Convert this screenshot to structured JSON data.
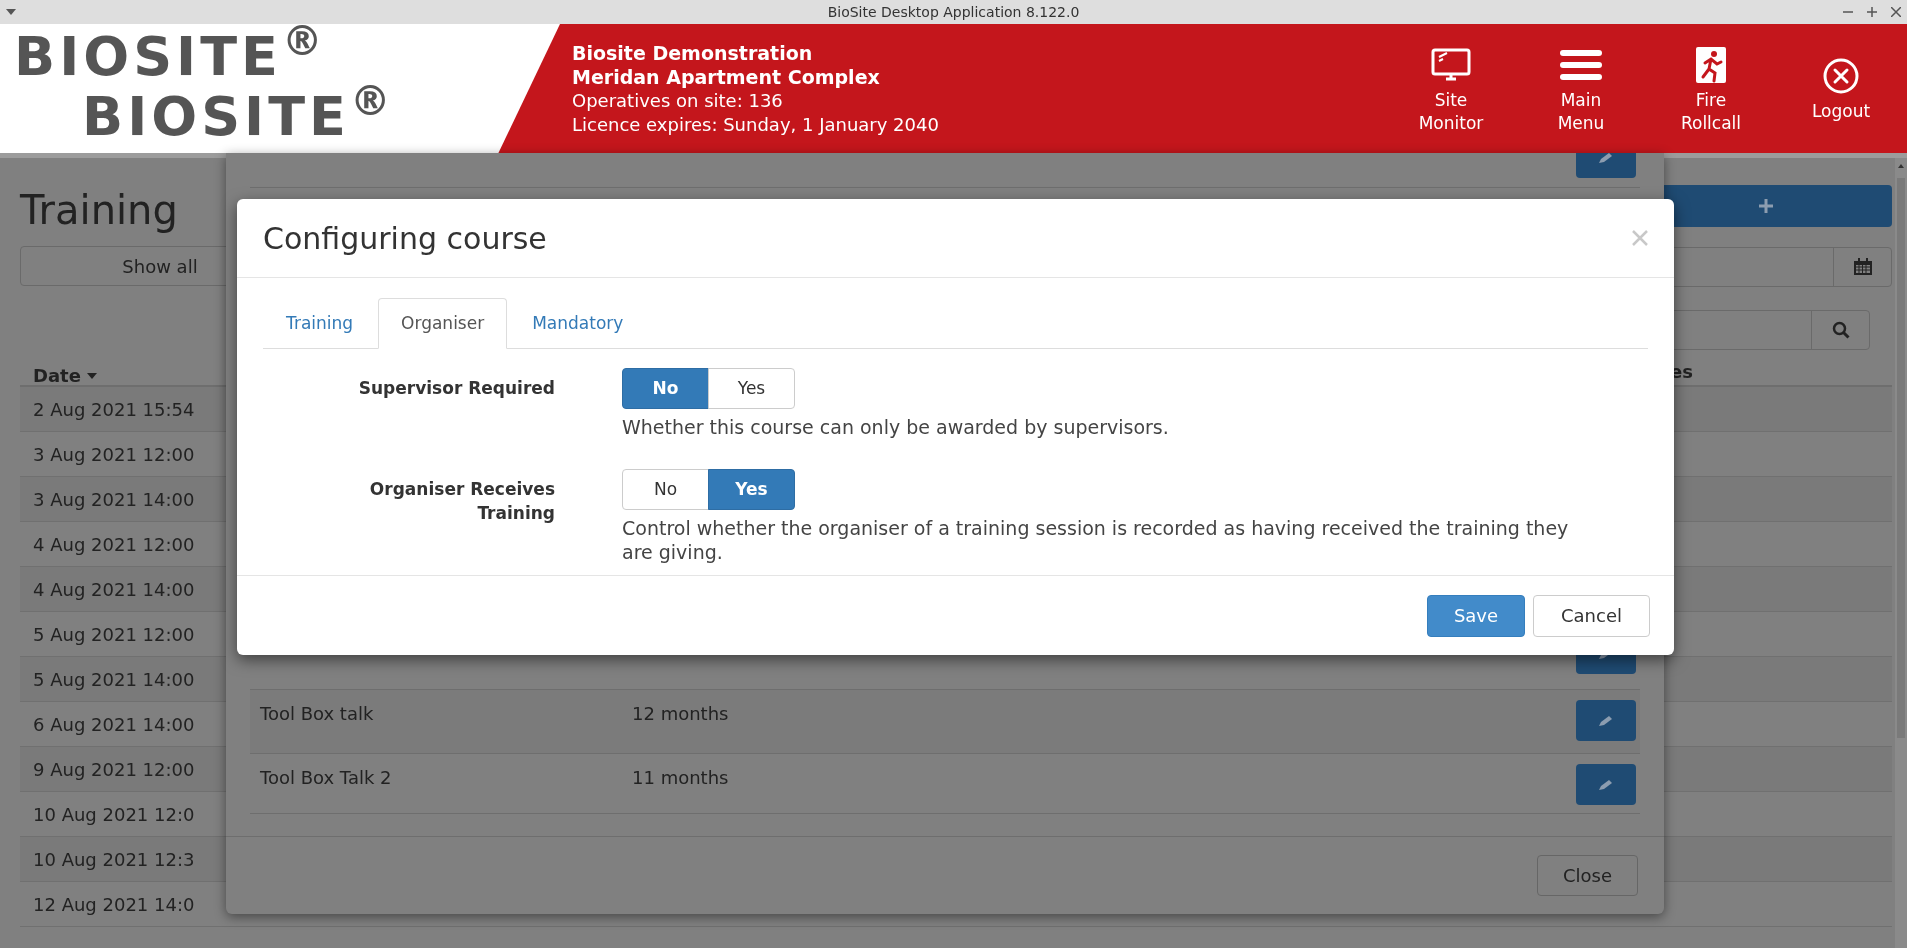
{
  "window": {
    "title": "BioSite Desktop Application 8.122.0"
  },
  "header": {
    "logos": [
      "BIOSITE$^{®}$",
      "BIOSITE$^{®}$"
    ],
    "info": {
      "company": "Biosite Demonstration",
      "site": "Meridan Apartment Complex",
      "operatives": "Operatives on site: 136",
      "licence": "Licence expires: Sunday, 1 January 2040"
    },
    "nav": [
      {
        "kind": "monitor",
        "label": "Site Monitor"
      },
      {
        "kind": "menu",
        "label": "Main Menu"
      },
      {
        "kind": "fire",
        "label": "Fire Rollcall"
      },
      {
        "kind": "logout",
        "label": "Logout"
      }
    ]
  },
  "page": {
    "title": "Training",
    "show_all": "Show all",
    "column_1": "Date",
    "column_partial": "es",
    "rows": [
      "2 Aug 2021 15:54",
      "3 Aug 2021 12:00",
      "3 Aug 2021 14:00",
      "4 Aug 2021 12:00",
      "4 Aug 2021 14:00",
      "5 Aug 2021 12:00",
      "5 Aug 2021 14:00",
      "6 Aug 2021 14:00",
      "9 Aug 2021 12:00",
      "10 Aug 2021 12:0",
      "10 Aug 2021 12:3",
      "12 Aug 2021 14:0"
    ]
  },
  "courses_dialog": {
    "rows": [
      {
        "name": "Tool Box talk",
        "period": "12 months"
      },
      {
        "name": "Tool Box Talk 2",
        "period": "11 months"
      }
    ],
    "close": "Close"
  },
  "dialog": {
    "title": "Configuring course",
    "tabs": [
      {
        "label": "Training",
        "selected": false
      },
      {
        "label": "Organiser",
        "selected": true
      },
      {
        "label": "Mandatory",
        "selected": false
      }
    ],
    "fields": [
      {
        "label": "Supervisor Required",
        "options": [
          {
            "label": "No",
            "selected": true
          },
          {
            "label": "Yes",
            "selected": false
          }
        ],
        "help": "Whether this course can only be awarded by supervisors."
      },
      {
        "label": "Organiser Receives Training",
        "options": [
          {
            "label": "No",
            "selected": false
          },
          {
            "label": "Yes",
            "selected": true
          }
        ],
        "help": "Control whether the organiser of a training session is recorded as having received the training they are giving."
      }
    ],
    "buttons": [
      {
        "kind": "primary",
        "label": "Save"
      },
      {
        "kind": "default",
        "label": "Cancel"
      }
    ]
  }
}
